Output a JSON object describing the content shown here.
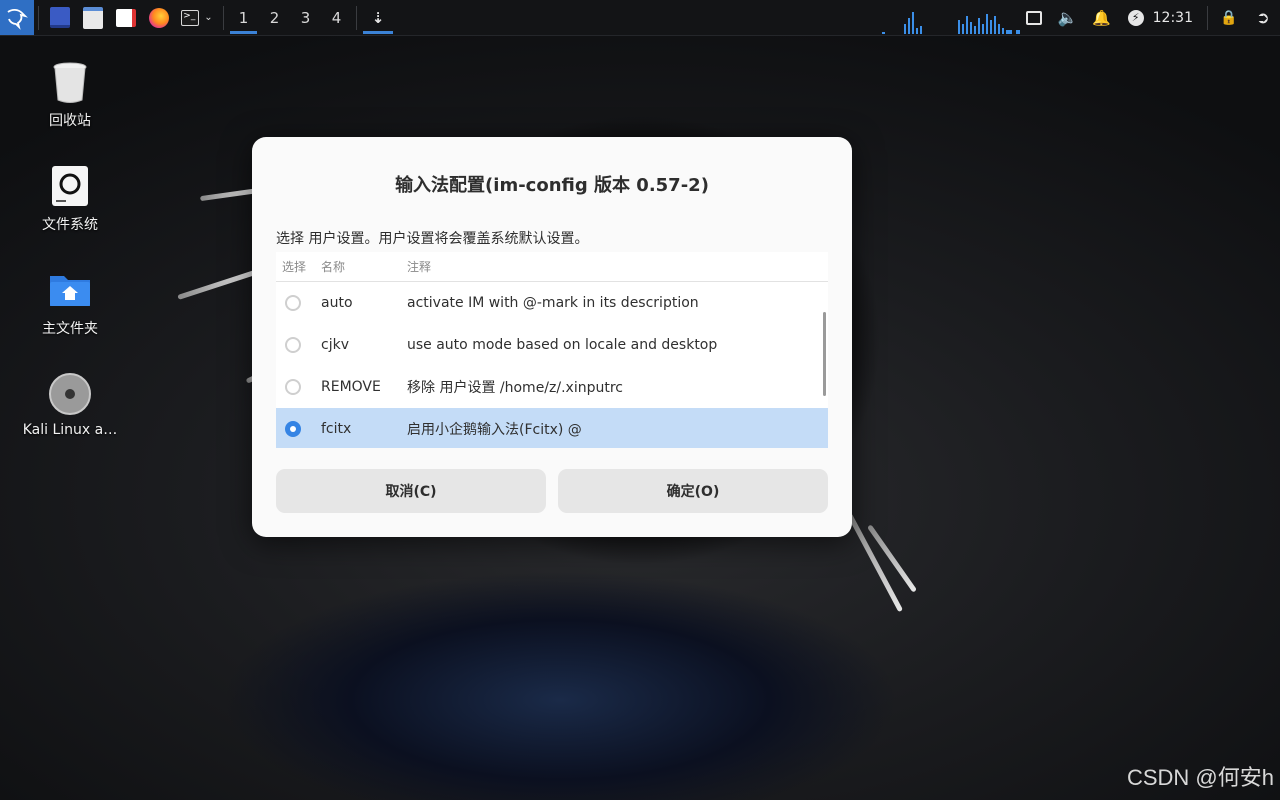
{
  "panel": {
    "workspaces": [
      "1",
      "2",
      "3",
      "4"
    ],
    "active_workspace": "1",
    "clock": "12:31",
    "launchers": [
      "app-menu-icon",
      "file-manager-icon",
      "text-editor-icon",
      "firefox-icon",
      "terminal-icon"
    ],
    "tray_icons": [
      "display-icon",
      "volume-icon",
      "notifications-icon",
      "power-icon",
      "lock-icon",
      "logout-icon"
    ]
  },
  "desktop": {
    "icons": [
      {
        "label": "回收站",
        "icon": "trash-icon"
      },
      {
        "label": "文件系统",
        "icon": "filesystem-icon"
      },
      {
        "label": "主文件夹",
        "icon": "home-folder-icon"
      },
      {
        "label": "Kali Linux a…",
        "icon": "disc-icon"
      }
    ]
  },
  "dialog": {
    "title": "输入法配置(im-config 版本 0.57-2)",
    "message": "选择 用户设置。用户设置将会覆盖系统默认设置。",
    "columns": [
      "选择",
      "名称",
      "注释"
    ],
    "rows": [
      {
        "name": "auto",
        "note": "activate IM with @-mark in its description",
        "selected": false
      },
      {
        "name": "cjkv",
        "note": "use auto mode based on locale and desktop",
        "selected": false
      },
      {
        "name": "REMOVE",
        "note": "移除 用户设置 /home/z/.xinputrc",
        "selected": false
      },
      {
        "name": "fcitx",
        "note": "启用小企鹅输入法(Fcitx) @",
        "selected": true
      }
    ],
    "cancel_label": "取消(C)",
    "ok_label": "确定(O)"
  },
  "watermark": "CSDN @何安h",
  "colors": {
    "accent": "#3584e4",
    "selected_row": "#c4dcf7",
    "panel": "#131416"
  }
}
